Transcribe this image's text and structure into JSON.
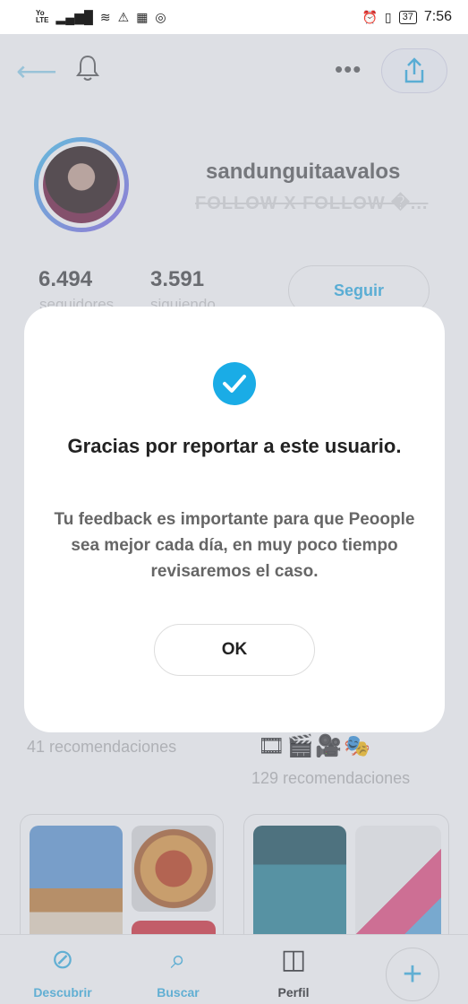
{
  "status_bar": {
    "lte_top": "Yo",
    "lte_bottom": "LTE",
    "signal_glyph": "▂▄▆█",
    "wifi_glyph": "≋",
    "warning_glyph": "⚠",
    "calendar_glyph": "▦",
    "instagram_glyph": "◎",
    "alarm_glyph": "⏰",
    "vibrate_glyph": "▯",
    "battery": "37",
    "time": "7:56"
  },
  "profile": {
    "username": "sandunguitaavalos",
    "bio": "FOLLOW X FOLLOW �...",
    "followers_count": "6.494",
    "followers_label": "seguidores",
    "following_count": "3.591",
    "following_label": "siguiendo",
    "follow_button": "Seguir"
  },
  "lists": {
    "left_recs": "41 recomendaciones",
    "right_emojis": "🎞🎬🎥🎭",
    "right_recs": "129 recomendaciones"
  },
  "bottom_nav": {
    "discover": "Descubrir",
    "search": "Buscar",
    "profile": "Perfil",
    "add": "+"
  },
  "modal": {
    "title": "Gracias por reportar a este usuario.",
    "message": "Tu feedback es importante para que Peoople sea mejor cada día, en muy poco tiempo revisaremos el caso.",
    "ok_button": "OK"
  },
  "colors": {
    "accent": "#1aace6",
    "avatar_ring_start": "#50c8f2",
    "avatar_ring_end": "#8e6de8"
  }
}
